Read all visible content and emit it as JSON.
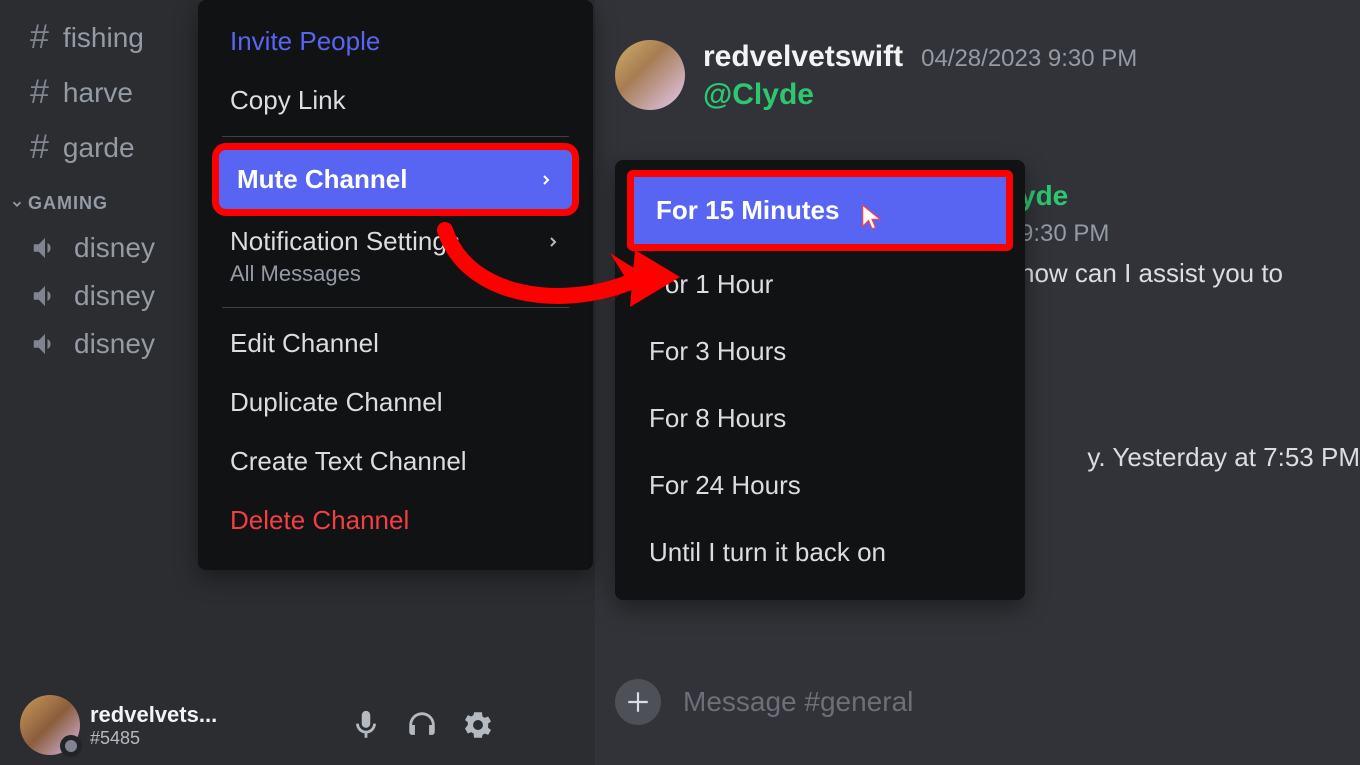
{
  "sidebar": {
    "text_channels": [
      {
        "label": "fishing"
      },
      {
        "label": "harve"
      },
      {
        "label": "garde"
      }
    ],
    "category": "GAMING",
    "voice_channels": [
      {
        "label": "disney"
      },
      {
        "label": "disney"
      },
      {
        "label": "disney"
      }
    ]
  },
  "user_panel": {
    "name": "redvelvets...",
    "tag": "#5485"
  },
  "context_menu": {
    "invite": "Invite People",
    "copy_link": "Copy Link",
    "mute": "Mute Channel",
    "notif_title": "Notification Settings",
    "notif_sub": "All Messages",
    "edit": "Edit Channel",
    "duplicate": "Duplicate Channel",
    "create": "Create Text Channel",
    "delete": "Delete Channel"
  },
  "mute_submenu": {
    "items": [
      "For 15 Minutes",
      "For 1 Hour",
      "For 3 Hours",
      "For 8 Hours",
      "For 24 Hours",
      "Until I turn it back on"
    ]
  },
  "chat": {
    "user": "redvelvetswift",
    "time": "04/28/2023 9:30 PM",
    "mention": "@Clyde",
    "reply_name": "yde",
    "reply_time": "9:30 PM",
    "reply_text": "how can I assist you to",
    "later_text": "y. Yesterday at 7:53 PM"
  },
  "input": {
    "placeholder": "Message #general"
  }
}
